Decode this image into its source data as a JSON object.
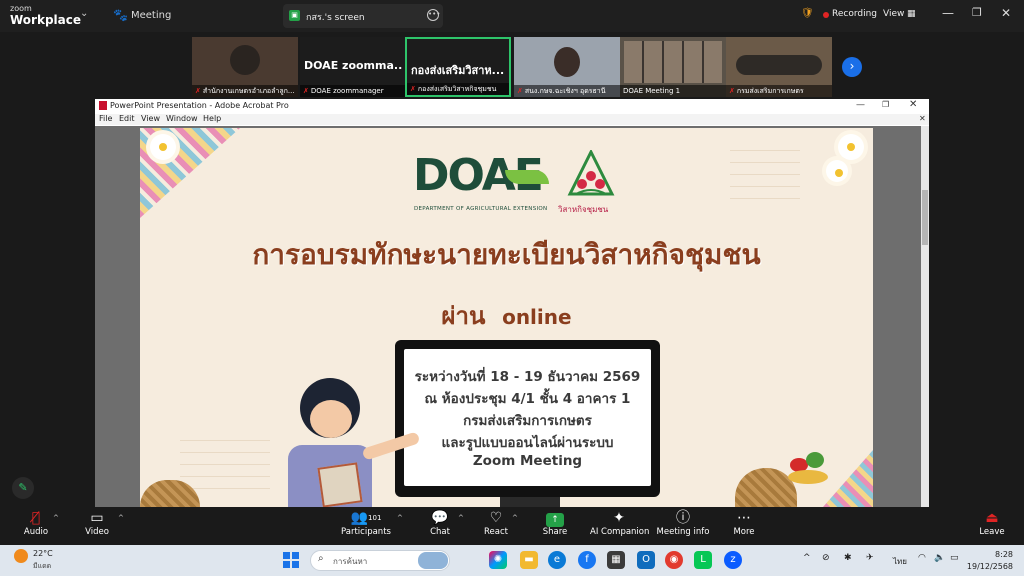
{
  "zoom": {
    "brand_small": "zoom",
    "brand_big": "Workplace",
    "meeting_label": "Meeting",
    "share_tab_label": "กสร.'s screen",
    "recording_label": "Recording",
    "view_label": "View"
  },
  "participants": [
    {
      "name": "สำนักงานเกษตรอำเภอลำลูก..."
    },
    {
      "display": "DOAE zoomma...",
      "name": "DOAE zoommanager"
    },
    {
      "display": "กองส่งเสริมวิสาห...",
      "name": "กองส่งเสริมวิสาหกิจชุมชน"
    },
    {
      "name": "สนง.กษจ.ฉะเชิงฯ อุดรธานี"
    },
    {
      "name": "DOAE Meeting 1"
    },
    {
      "name": "กรมส่งเสริมการเกษตร"
    }
  ],
  "acrobat": {
    "title": "PowerPoint Presentation - Adobe Acrobat Pro",
    "menu": [
      "File",
      "Edit",
      "View",
      "Window",
      "Help"
    ]
  },
  "slide": {
    "logo_text": "DOAE",
    "logo_subtitle": "DEPARTMENT OF AGRICULTURAL EXTENSION",
    "ce_label": "วิสาหกิจชุมชน",
    "title": "การอบรมทักษะนายทะเบียนวิสาหกิจชุมชน",
    "via_th": "ผ่าน",
    "via_en": "online",
    "screen_lines": [
      "ระหว่างวันที่ 18 - 19 ธันวาคม 2569",
      "ณ ห้องประชุม 4/1 ชั้น 4 อาคาร 1",
      "กรมส่งเสริมการเกษตร",
      "และรูปแบบออนไลน์ผ่านระบบ",
      "Zoom Meeting"
    ]
  },
  "toolbar": {
    "audio": "Audio",
    "video": "Video",
    "participants": "Participants",
    "participant_count": "101",
    "chat": "Chat",
    "react": "React",
    "share": "Share",
    "ai_companion": "AI Companion",
    "meeting_info": "Meeting info",
    "more": "More",
    "leave": "Leave"
  },
  "taskbar": {
    "temperature": "22°C",
    "weather_desc": "มีแดด",
    "search_placeholder": "การค้นหา",
    "language": "ไทย",
    "time": "8:28",
    "date": "19/12/2568"
  },
  "colors": {
    "accent_blue": "#1a6fe8",
    "share_green": "#24a148",
    "record_red": "#e02424",
    "slide_title": "#8a3e1e"
  }
}
